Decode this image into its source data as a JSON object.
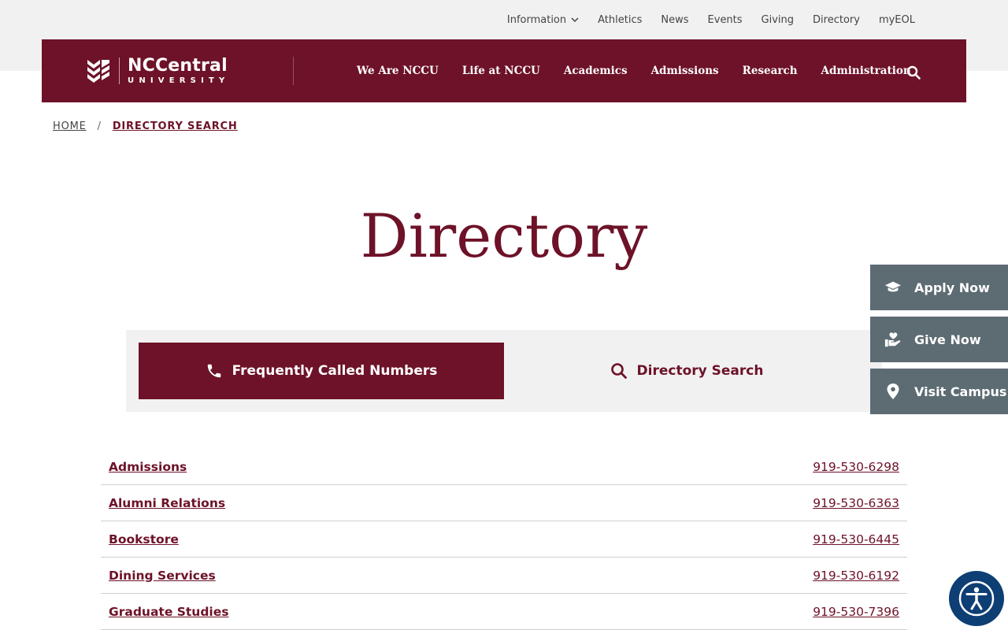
{
  "utility_nav": {
    "items": [
      "Information",
      "Athletics",
      "News",
      "Events",
      "Giving",
      "Directory",
      "myEOL"
    ]
  },
  "logo": {
    "line1": "NCCentral",
    "line2": "UNIVERSITY"
  },
  "main_nav": {
    "items": [
      "We Are NCCU",
      "Life at NCCU",
      "Academics",
      "Admissions",
      "Research",
      "Administration"
    ]
  },
  "breadcrumb": {
    "home": "HOME",
    "separator": "/",
    "current": "DIRECTORY SEARCH"
  },
  "page": {
    "title": "Directory"
  },
  "tabs": {
    "active_label": "Frequently Called Numbers",
    "inactive_label": "Directory Search"
  },
  "side_actions": [
    "Apply Now",
    "Give Now",
    "Visit Campus"
  ],
  "directory": [
    {
      "name": "Admissions",
      "phone": "919-530-6298"
    },
    {
      "name": "Alumni Relations",
      "phone": "919-530-6363"
    },
    {
      "name": "Bookstore",
      "phone": "919-530-6445"
    },
    {
      "name": "Dining Services",
      "phone": "919-530-6192"
    },
    {
      "name": "Graduate Studies",
      "phone": "919-530-7396"
    }
  ],
  "colors": {
    "brand_maroon": "#6d1228",
    "side_button_gray": "#5d6b73",
    "accessibility_blue": "#0d3e74"
  }
}
